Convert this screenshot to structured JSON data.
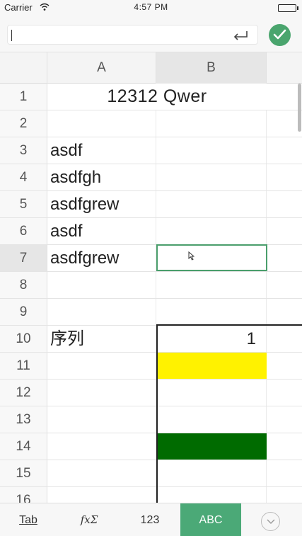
{
  "status_bar": {
    "carrier": "Carrier",
    "time": "4:57 PM",
    "wifi_icon": "wifi-icon",
    "battery_icon": "battery-icon"
  },
  "formula_bar": {
    "value": "",
    "enter_icon": "enter-icon",
    "confirm_icon": "checkmark-icon",
    "accent_color": "#4aa56e"
  },
  "columns": [
    "A",
    "B"
  ],
  "rows": [
    {
      "num": "1",
      "a": "12312 Qwer",
      "b": ""
    },
    {
      "num": "2",
      "a": "",
      "b": ""
    },
    {
      "num": "3",
      "a": "asdf",
      "b": ""
    },
    {
      "num": "4",
      "a": "asdfgh",
      "b": ""
    },
    {
      "num": "5",
      "a": "asdfgrew",
      "b": ""
    },
    {
      "num": "6",
      "a": "asdf",
      "b": ""
    },
    {
      "num": "7",
      "a": "asdfgrew",
      "b": ""
    },
    {
      "num": "8",
      "a": "",
      "b": ""
    },
    {
      "num": "9",
      "a": "",
      "b": ""
    },
    {
      "num": "10",
      "a": "序列",
      "b": "1"
    },
    {
      "num": "11",
      "a": "",
      "b": ""
    },
    {
      "num": "12",
      "a": "",
      "b": ""
    },
    {
      "num": "13",
      "a": "",
      "b": ""
    },
    {
      "num": "14",
      "a": "",
      "b": ""
    },
    {
      "num": "15",
      "a": "",
      "b": ""
    },
    {
      "num": "16",
      "a": "",
      "b": ""
    }
  ],
  "fills": {
    "B11": "#fff200",
    "B14": "#006b00"
  },
  "selected_cell": "B7",
  "selection_color": "#4a9e6c",
  "toolbar": {
    "tab": "Tab",
    "fx": "fxΣ",
    "num": "123",
    "abc": "ABC",
    "collapse_icon": "chevron-down-icon",
    "active_color": "#4ba977"
  }
}
